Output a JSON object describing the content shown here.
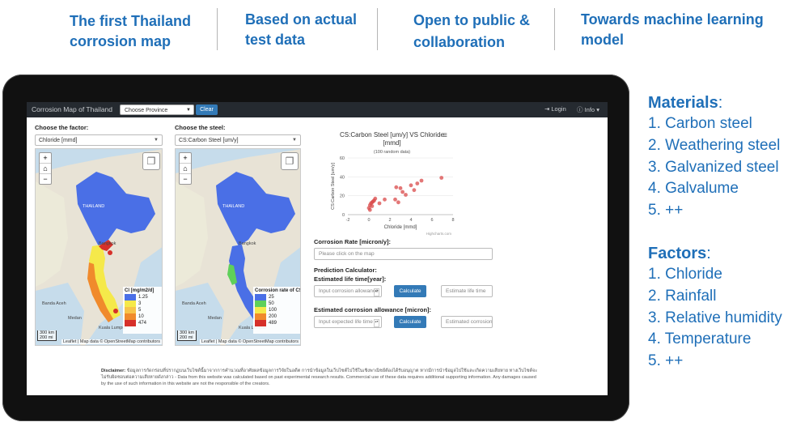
{
  "headlines": [
    {
      "line1": "The first Thailand",
      "line2": "corrosion map"
    },
    {
      "line1": "Based on actual",
      "line2": "test data"
    },
    {
      "line1": "Open to public &",
      "line2": "collaboration"
    },
    {
      "line1": "Towards machine learning",
      "line2": "model"
    }
  ],
  "app": {
    "brand": "Corrosion Map of Thailand",
    "province_select": "Choose Province",
    "clear_label": "Clear",
    "login_label": "Login",
    "info_label": "Info"
  },
  "factor_panel": {
    "label": "Choose the factor:",
    "selected": "Chloride [mmd]",
    "legend_title": "Cl [mg/m2/d]",
    "legend": [
      {
        "label": "1.25",
        "color": "#4a6fe6"
      },
      {
        "label": "3",
        "color": "#f5e94a"
      },
      {
        "label": "5",
        "color": "#f7c44a"
      },
      {
        "label": "10",
        "color": "#f08a2c"
      },
      {
        "label": "474",
        "color": "#d6302a"
      }
    ],
    "scale_km": "300 km",
    "scale_mi": "200 mi",
    "attribution": "Leaflet | Map data © OpenStreetMap contributors",
    "cities": {
      "bangkok": "Bangkok",
      "banda_aceh": "Banda Aceh",
      "medan": "Medan",
      "kuala_lumpur": "Kuala Lumpur",
      "thailand": "THAILAND"
    }
  },
  "steel_panel": {
    "label": "Choose the steel:",
    "selected": "CS:Carbon Steel [um/y]",
    "legend_title": "Corrosion rate of CS",
    "legend": [
      {
        "label": "25",
        "color": "#4a6fe6"
      },
      {
        "label": "50",
        "color": "#5fd05a"
      },
      {
        "label": "100",
        "color": "#f5e94a"
      },
      {
        "label": "200",
        "color": "#f08a2c"
      },
      {
        "label": "489",
        "color": "#d6302a"
      }
    ],
    "scale_km": "300 km",
    "scale_mi": "200 mi",
    "attribution": "Leaflet | Map data © OpenStreetMap contributors",
    "cities": {
      "bangkok": "Bangkok",
      "banda_aceh": "Banda Aceh",
      "medan": "Medan",
      "kuala_lumpur": "Kuala Lumpur",
      "thailand": "THAILAND"
    }
  },
  "chart_data": {
    "type": "scatter",
    "title": "CS:Carbon Steel [um/y] VS Chloride [mmd]",
    "subtitle": "(100 random data)",
    "xlabel": "Chloride [mmd]",
    "ylabel": "CS:Carbon Steel [um/y]",
    "xlim": [
      -2,
      8
    ],
    "ylim": [
      0,
      60
    ],
    "xticks": [
      -2,
      0,
      2,
      4,
      6,
      8
    ],
    "yticks": [
      0,
      20,
      40,
      60
    ],
    "credit": "Highcharts.com",
    "marker_color": "#d94a4a",
    "x": [
      0.0,
      0.1,
      0.2,
      0.3,
      0.4,
      0.5,
      0.6,
      0.1,
      0.3,
      1.0,
      1.5,
      2.5,
      2.6,
      2.8,
      3.0,
      3.2,
      3.5,
      4.0,
      4.3,
      4.6,
      5.0,
      6.9
    ],
    "y": [
      7,
      10,
      12,
      13,
      14,
      15,
      17,
      5,
      9,
      12,
      16,
      16,
      29,
      13,
      28,
      24,
      21,
      31,
      26,
      33,
      36,
      39
    ]
  },
  "calc": {
    "rate_label": "Corrosion Rate [micron/y]:",
    "rate_placeholder": "Please click on the map",
    "prediction_label": "Prediction Calculator:",
    "life_label": "Estimated life time[year]:",
    "life_input_placeholder": "Input corrosion allowance",
    "calculate_label": "Calculate",
    "life_output_placeholder": "Estimate life time",
    "allowance_label": "Estimated corrosion allowance [micron]:",
    "allowance_input_placeholder": "Input expected life time",
    "allowance_output_placeholder": "Estimated corrosion"
  },
  "disclaimer": {
    "label": "Disclaimer:",
    "text": "ข้อมูลการกัดกร่อนที่ปรากฏบนเว็บไซต์นี้มาจากการคำนวณที่อาศัยผลข้อมูลการวิจัยในอดีต การนำข้อมูลในเว็บไซต์ไปใช้ในเชิงพาณิชย์ต้องได้รับอนุญาต หากมีการนำข้อมูลไปใช้และเกิดความเสียหาย ทางเว็บไซต์จะไม่รับผิดชอบต่อความเสียหายดังกล่าว - Data from this website was calculated based on past experimental research results. Commercial use of these data requires additional supporting information. Any damages caused by the use of such information in this website are not the responsible of the creators."
  },
  "materials": {
    "heading": "Materials",
    "colon": ":",
    "items": [
      "1. Carbon steel",
      "2. Weathering steel",
      "3. Galvanized steel",
      "4. Galvalume",
      "5. ++"
    ]
  },
  "factors": {
    "heading": "Factors",
    "colon": ":",
    "items": [
      "1. Chloride",
      "2. Rainfall",
      "3. Relative humidity",
      "4. Temperature",
      "5. ++"
    ]
  }
}
